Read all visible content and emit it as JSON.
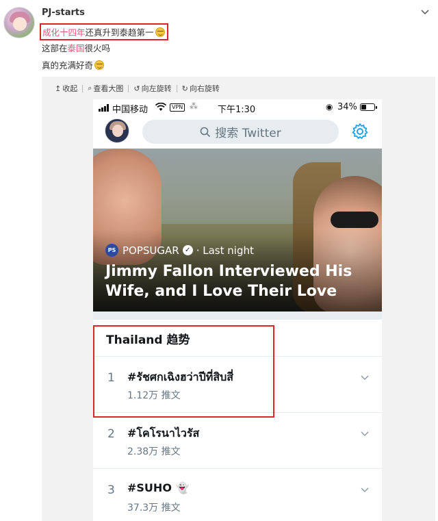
{
  "post": {
    "username": "PJ-starts",
    "line1_red": "成化十四年",
    "line1_rest": "还真升到泰趋第一",
    "line2_before": "这部在",
    "line2_red": "泰国",
    "line2_after": "很火吗",
    "line3": "真的充满好奇"
  },
  "viewer_toolbar": {
    "collapse": "收起",
    "view_large": "查看大图",
    "rotate_left": "向左旋转",
    "rotate_right": "向右旋转"
  },
  "phone": {
    "status": {
      "carrier": "中国移动",
      "vpn": "VPN",
      "time": "下午1:30",
      "battery": "34%"
    },
    "search_placeholder": "搜索 Twitter",
    "hero": {
      "publisher": "POPSUGAR",
      "publisher_badge": "PS",
      "time": "· Last night",
      "headline": "Jimmy Fallon Interviewed His Wife, and I Love Their Love"
    },
    "trends_title": "Thailand 趋势",
    "trends": [
      {
        "rank": "1",
        "name": "#รัชศกเฉิงฮว่าปีที่สิบสี่",
        "count": "1.12万 推文"
      },
      {
        "rank": "2",
        "name": "#โคโรนาไวรัส",
        "count": "2.38万 推文"
      },
      {
        "rank": "3",
        "name": "#SUHO 👻",
        "count": "37.3万 推文"
      }
    ]
  },
  "colors": {
    "highlight_red": "#e8567c",
    "box_red": "#d9262b",
    "twitter_blue": "#1da1f2"
  }
}
